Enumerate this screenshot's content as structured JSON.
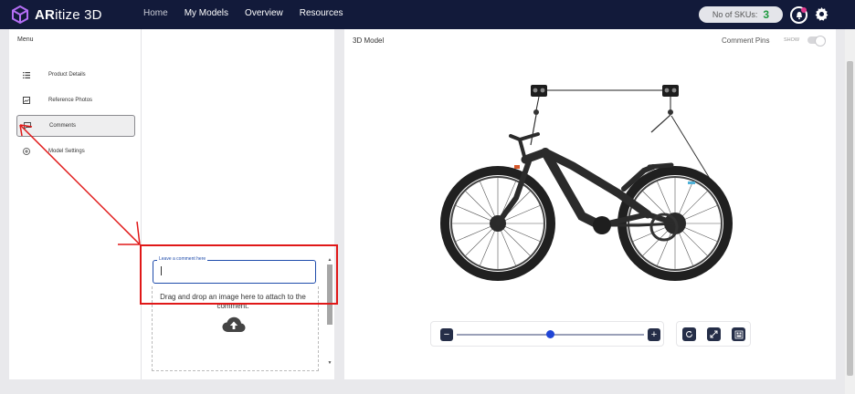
{
  "app": {
    "logo_bold": "AR",
    "logo_rest": "itize 3D"
  },
  "nav": {
    "items": [
      "Home",
      "My Models",
      "Overview",
      "Resources"
    ],
    "active": "Home"
  },
  "sku": {
    "label": "No of SKUs:",
    "count": "3",
    "count_color": "#1e9a3f"
  },
  "menu": {
    "title": "Menu",
    "items": [
      {
        "label": "Product Details",
        "icon": "list-icon"
      },
      {
        "label": "Reference Photos",
        "icon": "image-icon"
      },
      {
        "label": "Comments",
        "icon": "comment-icon",
        "active": true
      },
      {
        "label": "Model Settings",
        "icon": "plus-circle-icon"
      }
    ]
  },
  "comments": {
    "input_label": "Leave a comment here",
    "input_value": "",
    "drop_text": "Drag and drop an image here to attach to the comment.",
    "upload_icon": "cloud-upload-icon"
  },
  "model": {
    "title": "3D Model",
    "pins_label": "Comment Pins",
    "toggle_label": "SHOW",
    "toggle_on": false,
    "zoom_minus": "−",
    "zoom_plus": "+",
    "zoom_level": 0.5,
    "tools": [
      "rotate-icon",
      "fullscreen-icon",
      "ar-view-icon"
    ]
  },
  "colors": {
    "header_bg": "#121a3a",
    "accent": "#1f45d6",
    "annotation": "#e01818"
  }
}
